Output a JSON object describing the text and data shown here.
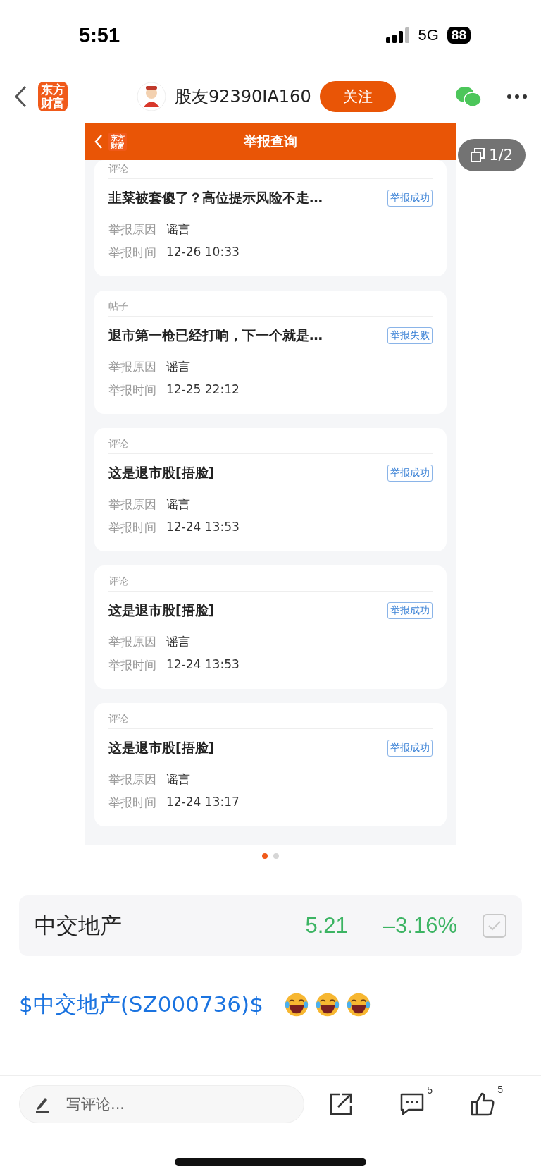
{
  "status_bar": {
    "time": "5:51",
    "network": "5G",
    "battery": "88"
  },
  "nav": {
    "logo": "东方财富",
    "username": "股友92390IA160",
    "follow": "关注"
  },
  "image_viewer": {
    "counter": "1/2",
    "screenshot": {
      "logo": "东方财富",
      "title": "举报查询",
      "reports": [
        {
          "type": "评论",
          "title": "韭菜被套傻了？高位提示风险不走…",
          "status": "举报成功",
          "reason_label": "举报原因",
          "reason": "谣言",
          "time_label": "举报时间",
          "time": "12-26 10:33"
        },
        {
          "type": "帖子",
          "title": "退市第一枪已经打响，下一个就是…",
          "status": "举报失败",
          "reason_label": "举报原因",
          "reason": "谣言",
          "time_label": "举报时间",
          "time": "12-25 22:12"
        },
        {
          "type": "评论",
          "title": "这是退市股[捂脸]",
          "status": "举报成功",
          "reason_label": "举报原因",
          "reason": "谣言",
          "time_label": "举报时间",
          "time": "12-24 13:53"
        },
        {
          "type": "评论",
          "title": "这是退市股[捂脸]",
          "status": "举报成功",
          "reason_label": "举报原因",
          "reason": "谣言",
          "time_label": "举报时间",
          "time": "12-24 13:53"
        },
        {
          "type": "评论",
          "title": "这是退市股[捂脸]",
          "status": "举报成功",
          "reason_label": "举报原因",
          "reason": "谣言",
          "time_label": "举报时间",
          "time": "12-24 13:17"
        }
      ]
    },
    "page_dots": [
      {
        "selected": true
      },
      {
        "selected": false
      }
    ]
  },
  "stock": {
    "name": "中交地产",
    "price": "5.21",
    "change": "–3.16%"
  },
  "post": {
    "link": "$中交地产(SZ000736)$",
    "emojis": [
      {
        "kind": "laughing"
      },
      {
        "kind": "laughing"
      },
      {
        "kind": "laughing"
      }
    ]
  },
  "bottom_bar": {
    "comment_placeholder": "写评论...",
    "comment_count": "5",
    "like_count": "5"
  }
}
